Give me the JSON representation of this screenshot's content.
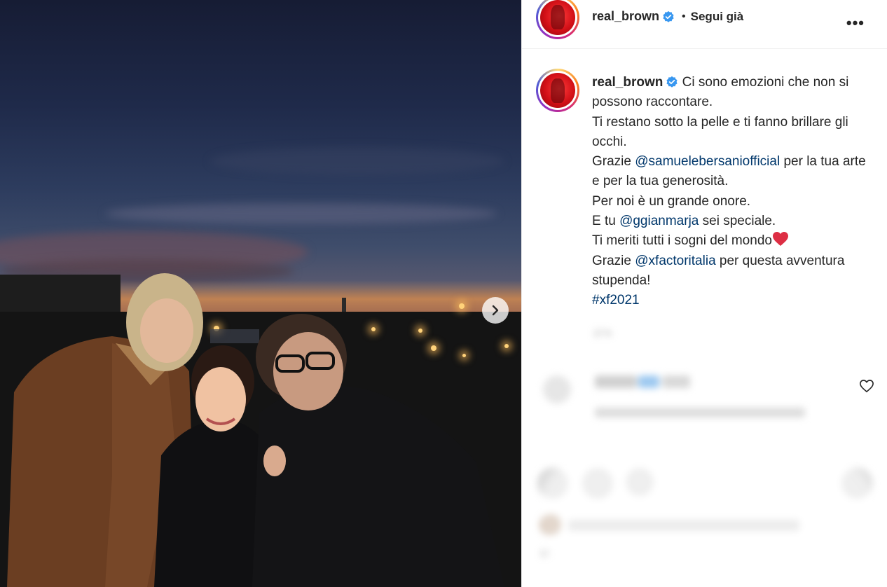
{
  "post": {
    "username": "real_brown",
    "follow_label": "Segui già",
    "separator": "•",
    "more_label": "•••"
  },
  "caption": {
    "username": "real_brown",
    "line1": "Ci sono emozioni che non si possono raccontare.",
    "line2": "Ti restano sotto la pelle e ti fanno brillare gli occhi.",
    "line3_pre": "Grazie ",
    "mention1": "@samuelebersaniofficial",
    "line3_post": " per la tua arte e per la tua generosità.",
    "line4": "Per noi è un grande onore.",
    "line5_pre": "E tu ",
    "mention2": "@ggianmarja",
    "line5_post": " sei speciale.",
    "line6": "Ti meriti tutti i sogni del mondo",
    "line7_pre": "Grazie ",
    "mention3": "@xfactoritalia",
    "line7_post": " per questa avventura stupenda!",
    "hashtag": "#xf2021"
  },
  "blurred": {
    "time": "17 h",
    "bottom_time": "17"
  },
  "colors": {
    "mention": "#00376b",
    "verified": "#3897f0",
    "text": "#262626",
    "muted": "#8e8e8e"
  },
  "icons": {
    "verified": "verified-badge-icon",
    "next": "chevron-right-icon",
    "more": "more-options-icon",
    "heart": "heart-icon"
  }
}
